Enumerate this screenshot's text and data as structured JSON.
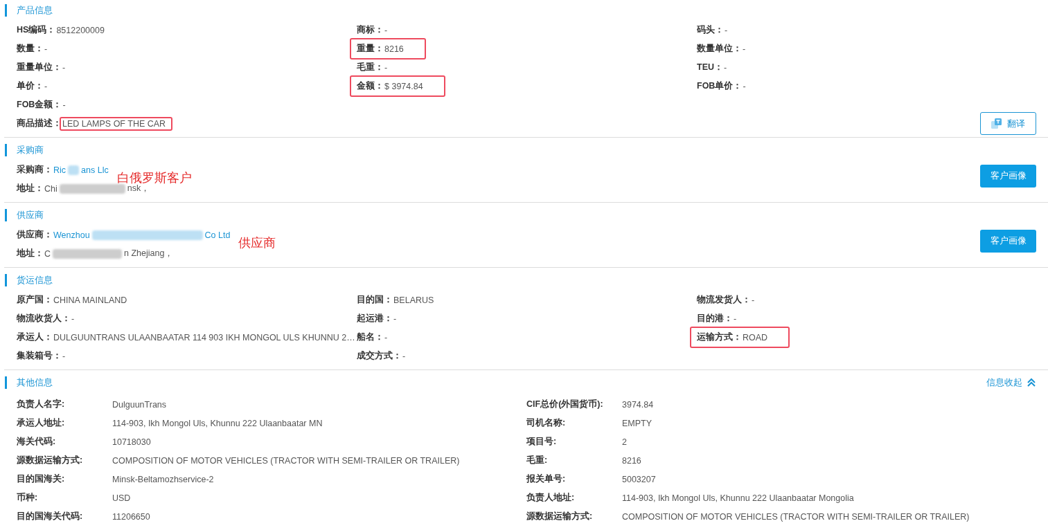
{
  "sections": [
    {
      "kind": "grid3",
      "title": "产品信息",
      "rows": [
        [
          {
            "label": "HS编码：",
            "value": "8512200009"
          },
          {
            "label": "商标：",
            "value": "-"
          },
          {
            "label": "码头：",
            "value": "-"
          }
        ],
        [
          {
            "label": "数量：",
            "value": "-"
          },
          {
            "label": "重量：",
            "value": "8216",
            "highlighted": true
          },
          {
            "label": "数量单位：",
            "value": "-"
          }
        ],
        [
          {
            "label": "重量单位：",
            "value": "-"
          },
          {
            "label": "毛重：",
            "value": "-"
          },
          {
            "label": "TEU：",
            "value": "-"
          }
        ],
        [
          {
            "label": "单价：",
            "value": "-"
          },
          {
            "label": "金额：",
            "value": "$ 3974.84",
            "highlighted": true
          },
          {
            "label": "FOB单价：",
            "value": "-"
          }
        ],
        [
          {
            "label": "FOB金额：",
            "value": "-"
          }
        ],
        [
          {
            "label": "商品描述：",
            "value": "LED LAMPS OF THE CAR",
            "value_highlighted": true
          }
        ]
      ],
      "button": {
        "kind": "translate",
        "label": "翻译"
      }
    },
    {
      "kind": "party",
      "title": "采购商",
      "rows": [
        [
          {
            "label": "采购商：",
            "value_parts": [
              "Ric",
              "ans Llc"
            ],
            "link": true
          }
        ],
        [
          {
            "label": "地址：",
            "value_parts": [
              "Chi",
              "nsk，"
            ],
            "link": false
          }
        ]
      ],
      "annotation": "白俄罗斯客户",
      "button": {
        "kind": "profile",
        "label": "客户画像"
      }
    },
    {
      "kind": "party",
      "title": "供应商",
      "rows": [
        [
          {
            "label": "供应商：",
            "value_parts": [
              "Wenzhou",
              "Co Ltd"
            ],
            "link": true
          }
        ],
        [
          {
            "label": "地址：",
            "value_parts": [
              "C",
              "n Zhejiang，"
            ],
            "link": false
          }
        ]
      ],
      "annotation": "供应商",
      "button": {
        "kind": "profile",
        "label": "客户画像"
      }
    },
    {
      "kind": "grid3",
      "title": "货运信息",
      "rows": [
        [
          {
            "label": "原产国：",
            "value": "CHINA MAINLAND"
          },
          {
            "label": "目的国：",
            "value": "BELARUS"
          },
          {
            "label": "物流发货人：",
            "value": "-"
          }
        ],
        [
          {
            "label": "物流收货人：",
            "value": "-"
          },
          {
            "label": "起运港：",
            "value": "-"
          },
          {
            "label": "目的港：",
            "value": "-"
          }
        ],
        [
          {
            "label": "承运人：",
            "value": "DULGUUNTRANS ULAANBAATAR 114 903 IKH MONGOL ULS KHUNNU 2…"
          },
          {
            "label": "船名：",
            "value": "-"
          },
          {
            "label": "运输方式：",
            "value": "ROAD",
            "highlighted": true
          }
        ],
        [
          {
            "label": "集装箱号：",
            "value": "-"
          },
          {
            "label": "成交方式：",
            "value": "-"
          }
        ]
      ]
    },
    {
      "kind": "table2",
      "title": "其他信息",
      "toggle": {
        "label": "信息收起",
        "expanded": true
      },
      "rows": [
        [
          {
            "label": "负责人名字:",
            "value": "DulguunTrans"
          },
          {
            "label": "CIF总价(外国货币):",
            "value": "3974.84"
          }
        ],
        [
          {
            "label": "承运人地址:",
            "value": "114-903, Ikh Mongol Uls, Khunnu 222 Ulaanbaatar MN"
          },
          {
            "label": "司机名称:",
            "value": "EMPTY"
          }
        ],
        [
          {
            "label": "海关代码:",
            "value": "10718030"
          },
          {
            "label": "项目号:",
            "value": "2"
          }
        ],
        [
          {
            "label": "源数据运输方式:",
            "value": "COMPOSITION OF MOTOR VEHICLES (TRACTOR WITH SEMI-TRAILER OR TRAILER)"
          },
          {
            "label": "毛重:",
            "value": "8216"
          }
        ],
        [
          {
            "label": "目的国海关:",
            "value": "Minsk-Beltamozhservice-2"
          },
          {
            "label": "报关单号:",
            "value": "5003207"
          }
        ],
        [
          {
            "label": "币种:",
            "value": "USD"
          },
          {
            "label": "负责人地址:",
            "value": "114-903, Ikh Mongol Uls, Khunnu 222 Ulaanbaatar Mongolia"
          }
        ],
        [
          {
            "label": "目的国海关代码:",
            "value": "11206650"
          },
          {
            "label": "源数据运输方式:",
            "value": "COMPOSITION OF MOTOR VEHICLES (TRACTOR WITH SEMI-TRAILER OR TRAILER)"
          }
        ]
      ]
    }
  ]
}
